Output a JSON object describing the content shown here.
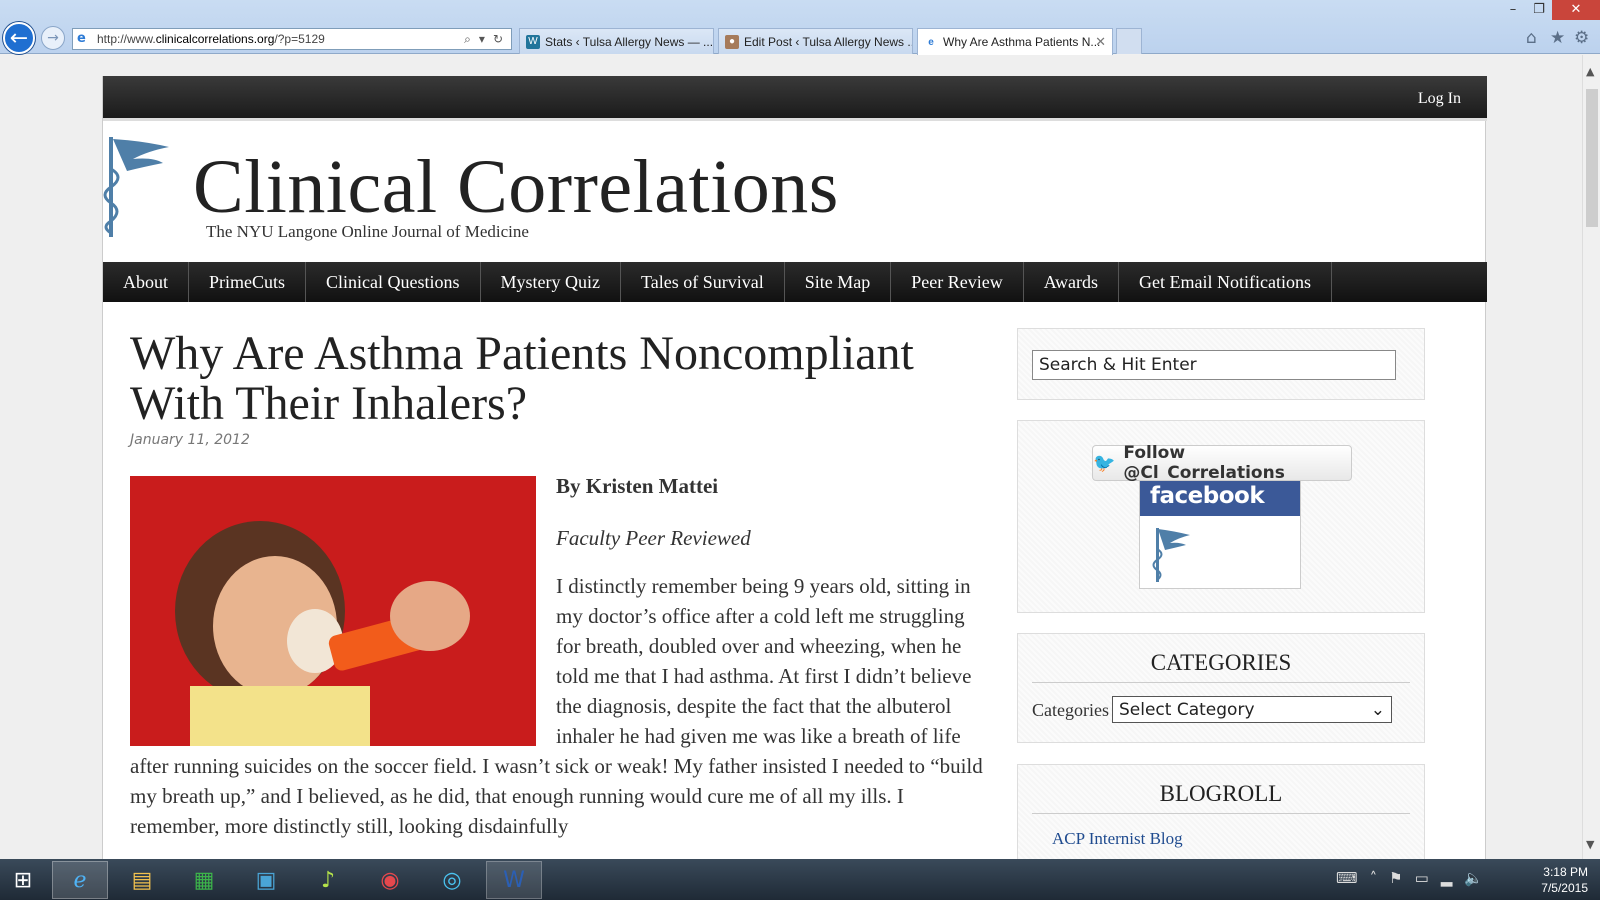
{
  "browser": {
    "url_prefix": "http://www.",
    "url_domain": "clinicalcorrelations.org",
    "url_suffix": "/?p=5129",
    "tabs": [
      {
        "label": "Stats ‹ Tulsa Allergy News — ..."
      },
      {
        "label": "Edit Post ‹ Tulsa Allergy News ..."
      },
      {
        "label": "Why Are Asthma Patients N..."
      }
    ],
    "close_tab": "✕"
  },
  "site": {
    "login": "Log In",
    "title": "Clinical Correlations",
    "tagline": "The NYU Langone Online Journal of Medicine",
    "nav": [
      "About",
      "PrimeCuts",
      "Clinical Questions",
      "Mystery Quiz",
      "Tales of Survival",
      "Site Map",
      "Peer Review",
      "Awards",
      "Get Email Notifications"
    ]
  },
  "post": {
    "title": "Why Are Asthma Patients Noncompliant With Their Inhalers?",
    "date": "January 11, 2012",
    "byline": "By Kristen Mattei",
    "review": "Faculty Peer Reviewed",
    "body": "I distinctly remember being 9 years old, sitting in my doctor’s office after a cold left me struggling for breath, doubled over and wheezing, when he told me that I had asthma. At first I didn’t believe the diagnosis, despite the fact that the albuterol inhaler he had given me was like a breath of life after running suicides on the soccer field. I wasn’t sick or weak! My father insisted I needed to “build my breath up,” and I believed, as he did, that enough running would cure me of all my ills. I remember, more distinctly still, looking disdainfully"
  },
  "sidebar": {
    "search_placeholder": "Search & Hit Enter",
    "twitter_follow": "Follow @Cl_Correlations",
    "facebook": "facebook",
    "categories_title": "CATEGORIES",
    "categories_label": "Categories",
    "categories_select": "Select Category",
    "blogroll_title": "BLOGROLL",
    "blogroll_links": [
      "ACP Internist Blog"
    ]
  },
  "taskbar": {
    "time": "3:18 PM",
    "date": "7/5/2015"
  }
}
